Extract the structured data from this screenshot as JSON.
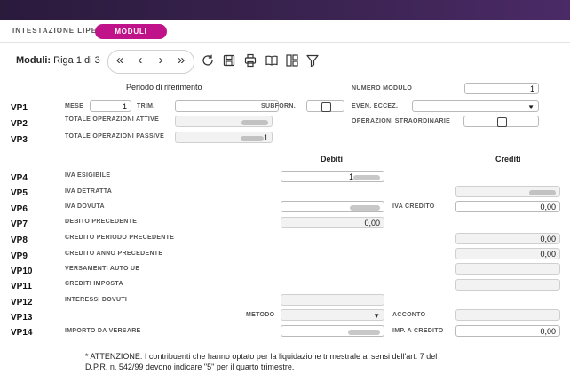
{
  "tabs": {
    "inactive_label": "INTESTAZIONE LIPE",
    "active_label": "MODULI"
  },
  "toolbar": {
    "title": "Moduli:",
    "record": "Riga 1 di 3"
  },
  "labels": {
    "periodo": "Periodo di riferimento",
    "numero_modulo": "NUMERO MODULO",
    "mese": "MESE",
    "trim": "TRIM.",
    "subforn": "SUBFORN.",
    "even_eccez": "EVEN. ECCEZ.",
    "tot_attive": "TOTALE OPERAZIONI ATTIVE",
    "op_straordinarie": "OPERAZIONI STRAORDINARIE",
    "tot_passive": "TOTALE OPERAZIONI PASSIVE",
    "debiti": "Debiti",
    "crediti": "Crediti",
    "iva_esigibile": "IVA ESIGIBILE",
    "iva_detratta": "IVA DETRATTA",
    "iva_dovuta": "IVA DOVUTA",
    "iva_credito": "IVA CREDITO",
    "debito_precedente": "DEBITO PRECEDENTE",
    "credito_periodo_precedente": "CREDITO PERIODO PRECEDENTE",
    "credito_anno_precedente": "CREDITO ANNO PRECEDENTE",
    "versamenti_auto_ue": "VERSAMENTI AUTO UE",
    "crediti_imposta": "CREDITI IMPOSTA",
    "interessi_dovuti": "INTERESSI DOVUTI",
    "metodo": "METODO",
    "acconto": "ACCONTO",
    "importo_da_versare": "IMPORTO DA VERSARE",
    "imp_a_credito": "IMP. A CREDITO"
  },
  "codes": [
    "VP1",
    "VP2",
    "VP3",
    "VP4",
    "VP5",
    "VP6",
    "VP7",
    "VP8",
    "VP9",
    "VP10",
    "VP11",
    "VP12",
    "VP13",
    "VP14"
  ],
  "values": {
    "numero_modulo": "1",
    "mese": "1",
    "tot_attive_suffix": "",
    "tot_passive_suffix": "1",
    "iva_esigibile_prefix": "1",
    "iva_credito": "0,00",
    "debito_precedente": "0,00",
    "credito_periodo_precedente": "0,00",
    "credito_anno_precedente": "0,00",
    "imp_a_credito": "0,00"
  },
  "note": "* ATTENZIONE: I contribuenti che hanno optato per la liquidazione trimestrale ai sensi dell'art. 7 del D.P.R. n. 542/99 devono indicare \"5\" per il quarto trimestre."
}
